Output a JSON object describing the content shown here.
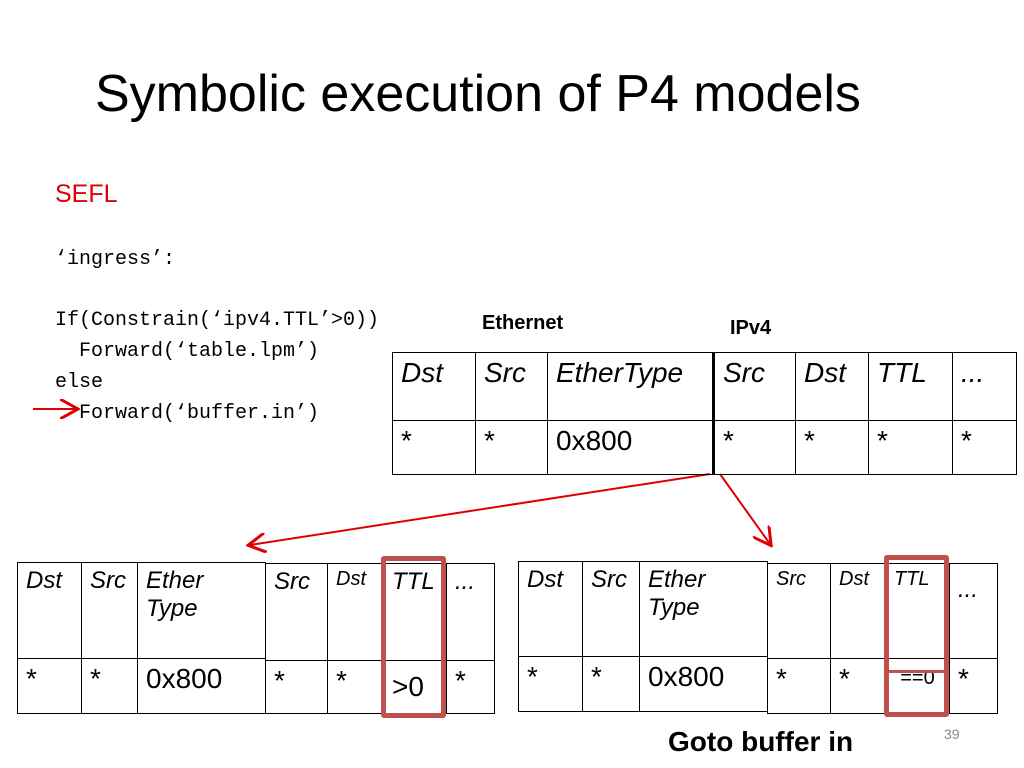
{
  "title": "Symbolic execution of P4 models",
  "sefl_label": "SEFL",
  "code": {
    "line1": "‘ingress’:",
    "line2": "If(Constrain(‘ipv4.TTL’>0))",
    "line3": "  Forward(‘table.lpm’)",
    "line4": "else",
    "line5": "  Forward(‘buffer.in’)"
  },
  "labels": {
    "ethernet": "Ethernet",
    "ipv4": "IPv4"
  },
  "top_table": {
    "headers": [
      "Dst",
      "Src",
      "EtherType",
      "Src",
      "Dst",
      "TTL",
      "..."
    ],
    "values": [
      "*",
      "*",
      "0x800",
      "*",
      "*",
      "*",
      "*"
    ]
  },
  "left_table": {
    "eth_headers": [
      "Dst",
      "Src",
      "Ether Type"
    ],
    "eth_values": [
      "*",
      "*",
      "0x800"
    ],
    "ip_headers": [
      "Src",
      "Dst",
      "TTL",
      "..."
    ],
    "ip_values": [
      "*",
      "*",
      ">0",
      "*"
    ]
  },
  "right_table": {
    "eth_headers": [
      "Dst",
      "Src",
      "Ether Type"
    ],
    "eth_values": [
      "*",
      "*",
      "0x800"
    ],
    "ip_headers": [
      "Src",
      "Dst",
      "TTL",
      "..."
    ],
    "ip_values": [
      "*",
      "*",
      "==0",
      "*"
    ]
  },
  "goto_text": "Goto buffer in",
  "page_number": "39",
  "colors": {
    "accent_red": "#e00000",
    "highlight": "#c0504d"
  }
}
